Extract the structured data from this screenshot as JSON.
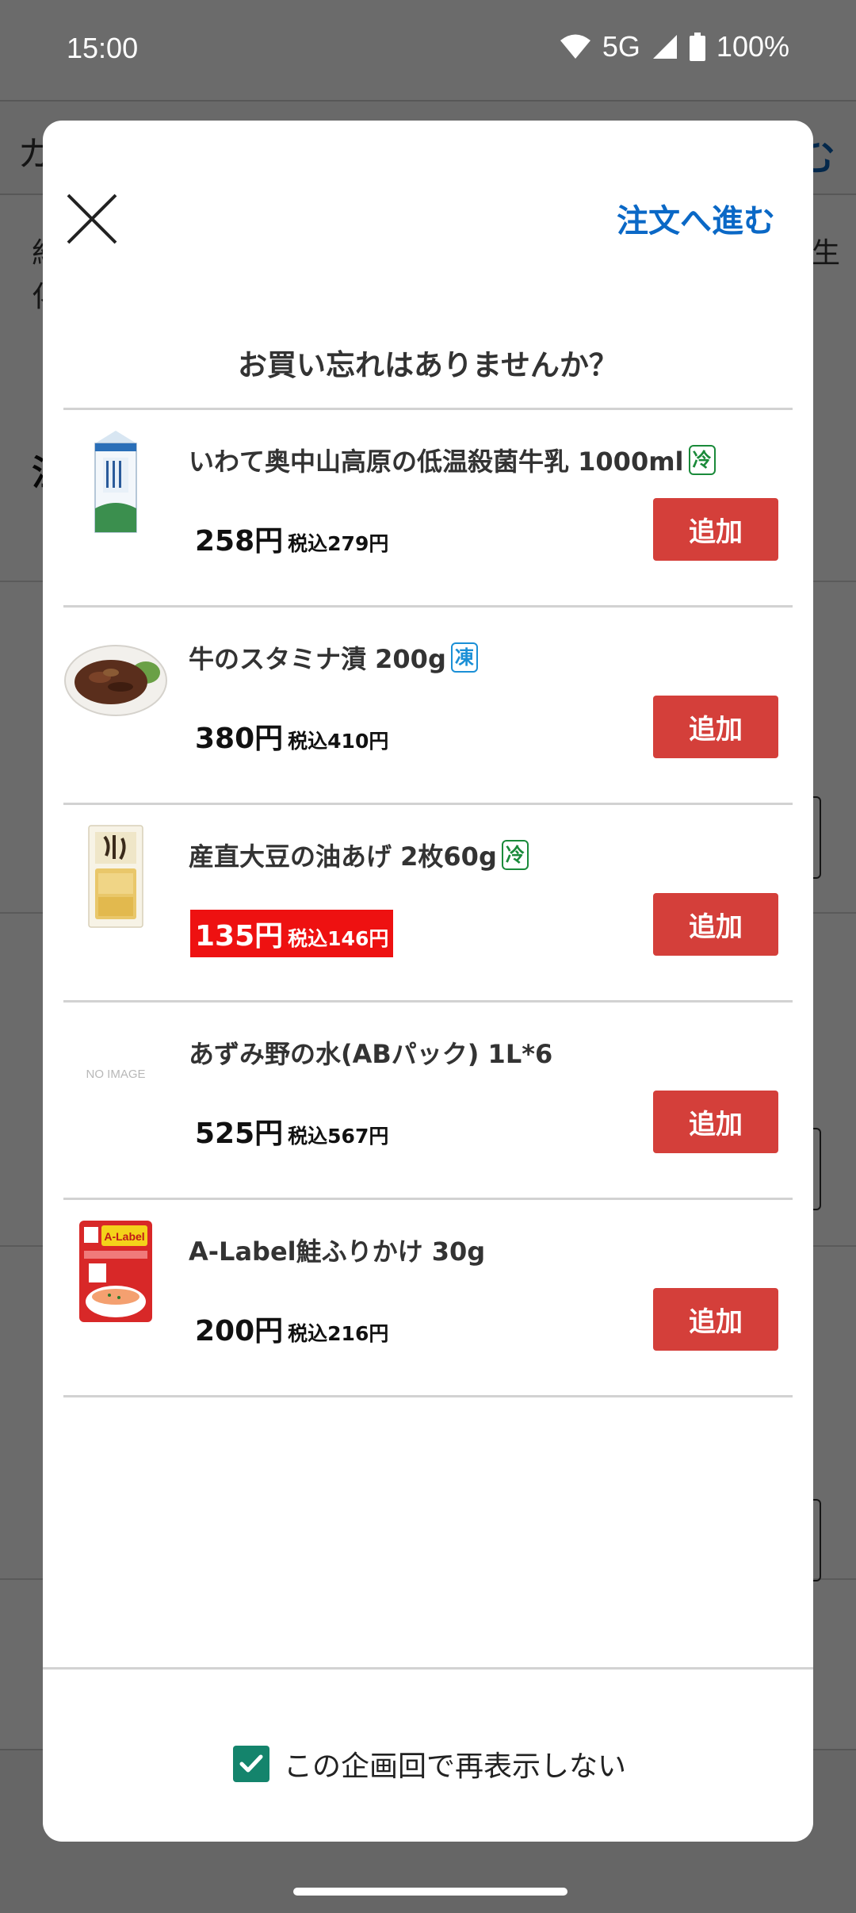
{
  "status_bar": {
    "time": "15:00",
    "network": "5G",
    "battery": "100%"
  },
  "background": {
    "topbar_left": "カ",
    "topbar_right": "む",
    "text_line1": "約",
    "text_line2": "化",
    "right_text": "生",
    "heading": "注"
  },
  "modal": {
    "proceed_label": "注文へ進む",
    "title": "お買い忘れはありませんか？",
    "add_label": "追加",
    "products": [
      {
        "name": "いわて奥中山高原の低温殺菌牛乳 1000ml",
        "badge": "冷",
        "badge_type": "chilled",
        "price": "258円",
        "tax_price": "税込279円",
        "sale": false,
        "image": "milk-carton"
      },
      {
        "name": "牛のスタミナ漬 200g",
        "badge": "凍",
        "badge_type": "frozen",
        "price": "380円",
        "tax_price": "税込410円",
        "sale": false,
        "image": "beef-plate"
      },
      {
        "name": "産直大豆の油あげ 2枚60g",
        "badge": "冷",
        "badge_type": "chilled",
        "price": "135円",
        "tax_price": "税込146円",
        "sale": true,
        "image": "fried-tofu"
      },
      {
        "name": "あずみ野の水(ABパック) 1L*6",
        "badge": "",
        "badge_type": "",
        "price": "525円",
        "tax_price": "税込567円",
        "sale": false,
        "image": "no-image",
        "image_text": "NO IMAGE"
      },
      {
        "name": "A-Label鮭ふりかけ 30g",
        "badge": "",
        "badge_type": "",
        "price": "200円",
        "tax_price": "税込216円",
        "sale": false,
        "image": "furikake-pack",
        "image_text": "A-Label"
      }
    ],
    "footer_checkbox_label": "この企画回で再表示しない",
    "footer_checked": true
  },
  "colors": {
    "accent_blue": "#0a68c6",
    "add_button_red": "#d43f3a",
    "sale_red": "#ee1111",
    "checkbox_green": "#14846c"
  }
}
